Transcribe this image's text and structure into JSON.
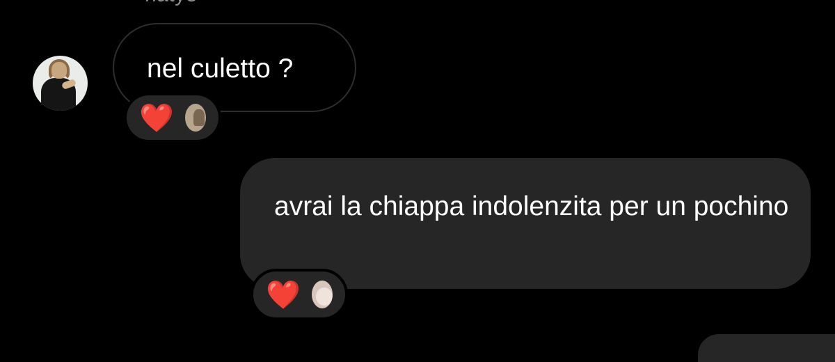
{
  "conversation": {
    "sender_name": "natye",
    "messages": [
      {
        "direction": "incoming",
        "text": "nel culetto ?",
        "reactions": {
          "emoji": "❤️",
          "reactor_avatar": "user-avatar-photo"
        }
      },
      {
        "direction": "outgoing",
        "text": "avrai la chiappa indolenzita per un pochino",
        "reactions": {
          "emoji": "❤️",
          "reactor_avatar": "user-avatar-photo"
        }
      }
    ]
  },
  "colors": {
    "background": "#000000",
    "outgoing_bubble": "#262626",
    "incoming_border": "#2e2e2e",
    "sender_name": "#8e8e8e",
    "heart": "#e8202c"
  }
}
